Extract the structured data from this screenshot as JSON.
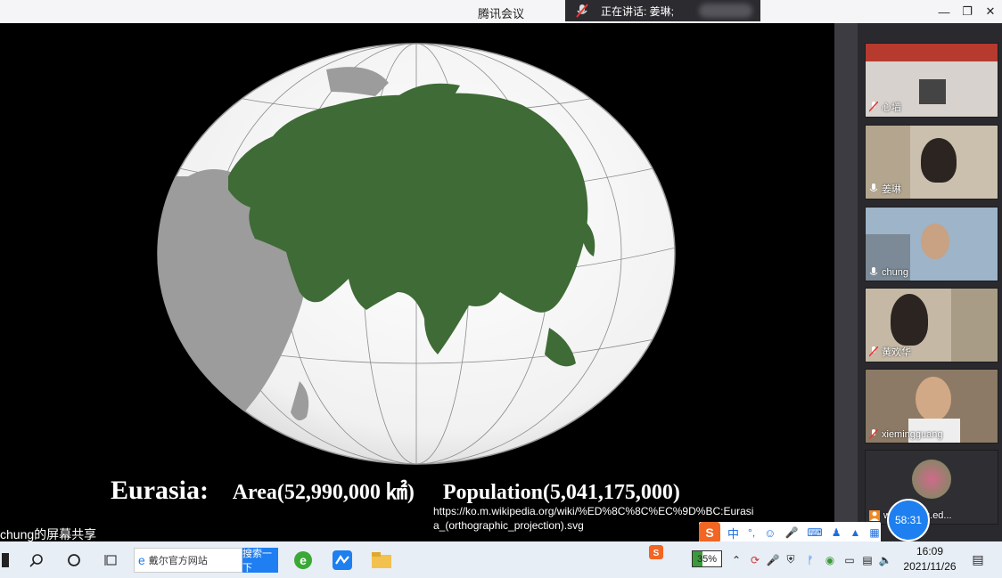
{
  "window": {
    "title": "腾讯会议",
    "speaking_label": "正在讲话: 姜琳;"
  },
  "slide": {
    "title": "Eurasia:",
    "area": "Area(52,990,000 ㎢)",
    "population": "Population(5,041,175,000)",
    "source_url": "https://ko.m.wikipedia.org/wiki/%ED%8C%8C%EC%9D%BC:Eurasia_(orthographic_projection).svg"
  },
  "share_label": "chung的屏幕共享",
  "participants": [
    {
      "name": "心墙",
      "mic": "muted",
      "scene": "office"
    },
    {
      "name": "姜琳",
      "mic": "on",
      "scene": "room"
    },
    {
      "name": "chung",
      "mic": "on",
      "scene": "city"
    },
    {
      "name": "黄欢华",
      "mic": "muted",
      "scene": "room"
    },
    {
      "name": "xiemingguang",
      "mic": "muted",
      "scene": "room"
    },
    {
      "name": "wen@bfsu.ed...",
      "mic": "avatar",
      "scene": "avatar"
    }
  ],
  "timer": "58:31",
  "ime": {
    "lang": "中"
  },
  "taskbar": {
    "search_text": "戴尔官方网站",
    "search_button": "搜索一下",
    "battery": "35%",
    "time": "16:09",
    "date": "2021/11/26"
  },
  "colors": {
    "land_highlight": "#3f6b36",
    "land_other": "#9c9c9c",
    "ocean": "#ffffff",
    "accent": "#1d7ff0"
  }
}
